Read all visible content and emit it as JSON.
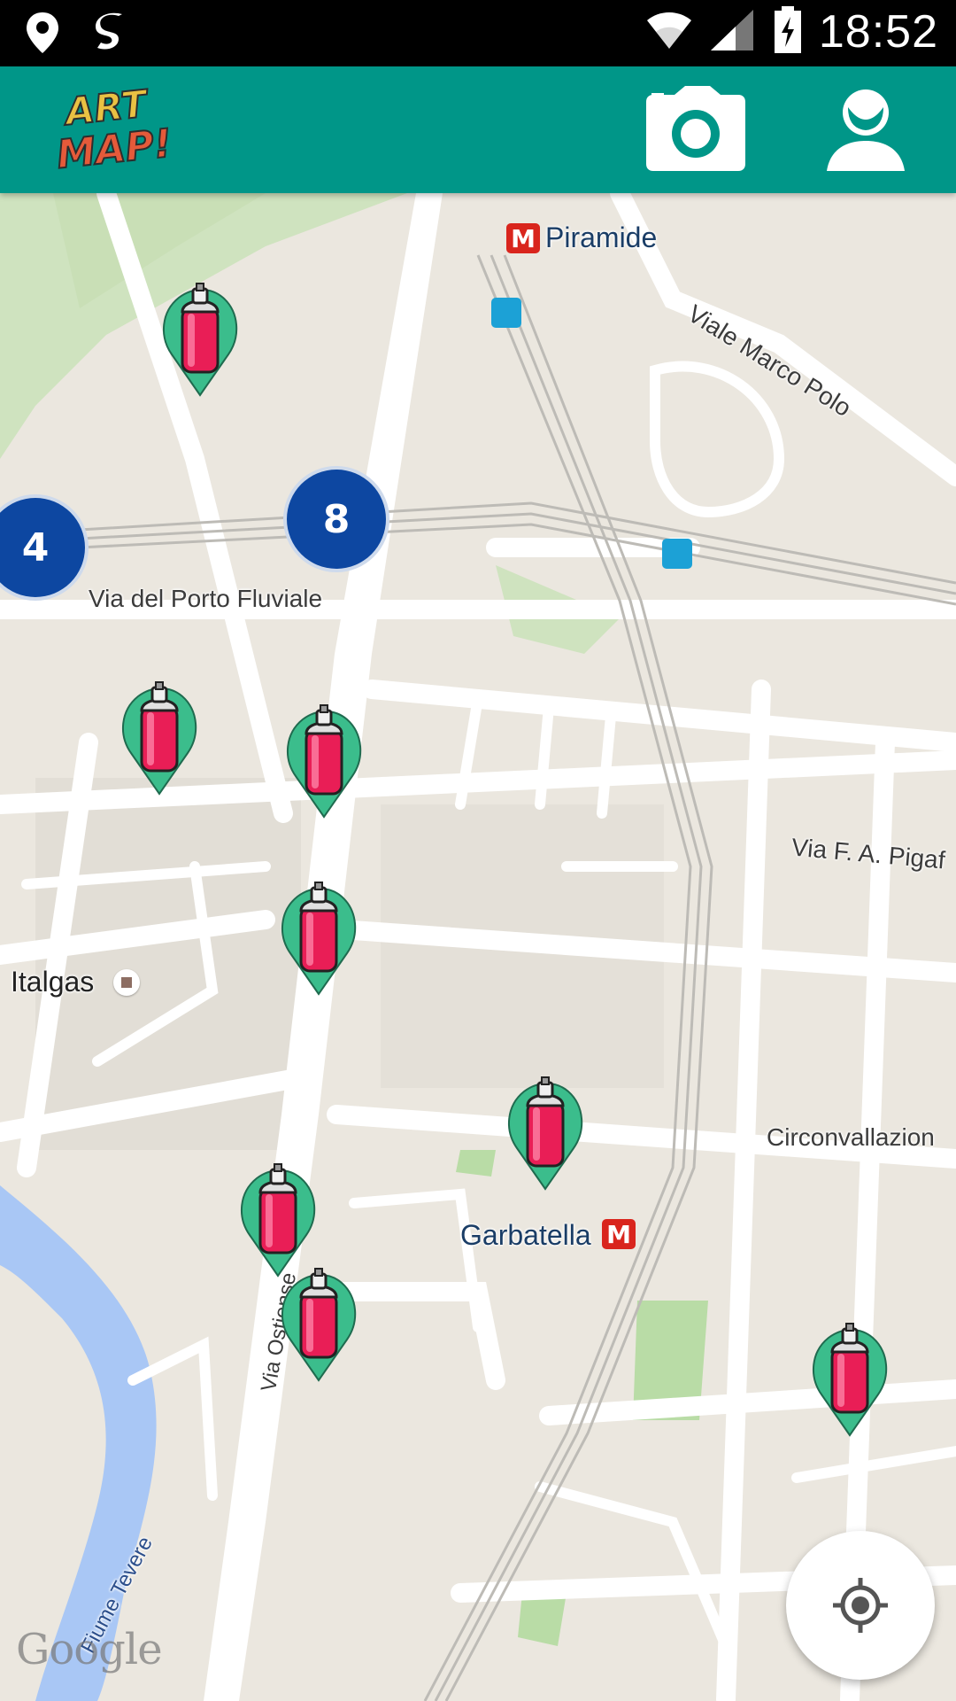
{
  "status_bar": {
    "time": "18:52",
    "icons": [
      "location-icon",
      "s-app-icon",
      "wifi-icon",
      "signal-icon",
      "battery-charging-icon"
    ]
  },
  "app_bar": {
    "logo_line1": "ART",
    "logo_line2": "MAP!",
    "camera_icon": "camera-icon",
    "profile_icon": "person-icon",
    "color": "#009688"
  },
  "map": {
    "labels": {
      "piramide": "Piramide",
      "viale_marco_polo": "Viale Marco Polo",
      "via_porto_fluviale": "Via del Porto Fluviale",
      "via_pigafetta": "Via F. A. Pigaf",
      "italgas": "Italgas",
      "circonvallazione": "Circonvallazion",
      "garbatella": "Garbatella",
      "via_ostiense": "Via Ostiense",
      "fiume_tevere": "Fiume Tevere"
    },
    "clusters": [
      {
        "count": "4"
      },
      {
        "count": "8"
      }
    ],
    "metro_symbol": "M",
    "attribution": "Google",
    "marker_icon": "spray-can-icon",
    "cluster_color": "#0d47a1"
  },
  "controls": {
    "my_location_icon": "my-location-icon"
  }
}
